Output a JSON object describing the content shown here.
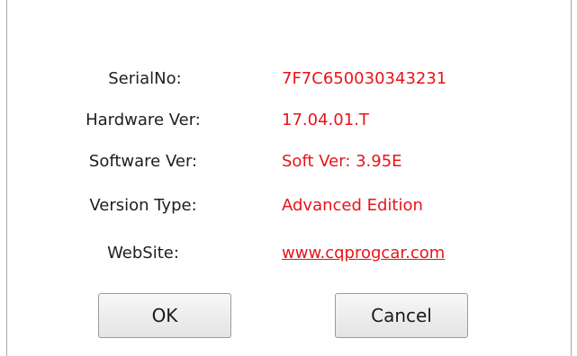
{
  "info": {
    "serial": {
      "label": "SerialNo:",
      "value": "7F7C650030343231"
    },
    "hardware": {
      "label": "Hardware Ver:",
      "value": "17.04.01.T"
    },
    "software": {
      "label": "Software Ver:",
      "value": "Soft Ver: 3.95E"
    },
    "version_type": {
      "label": "Version Type:",
      "value": "Advanced Edition"
    },
    "website": {
      "label": "WebSite:",
      "value": "www.cqprogcar.com"
    }
  },
  "buttons": {
    "ok": "OK",
    "cancel": "Cancel"
  },
  "colors": {
    "value_text": "#e8141a",
    "label_text": "#1e1e1e"
  }
}
